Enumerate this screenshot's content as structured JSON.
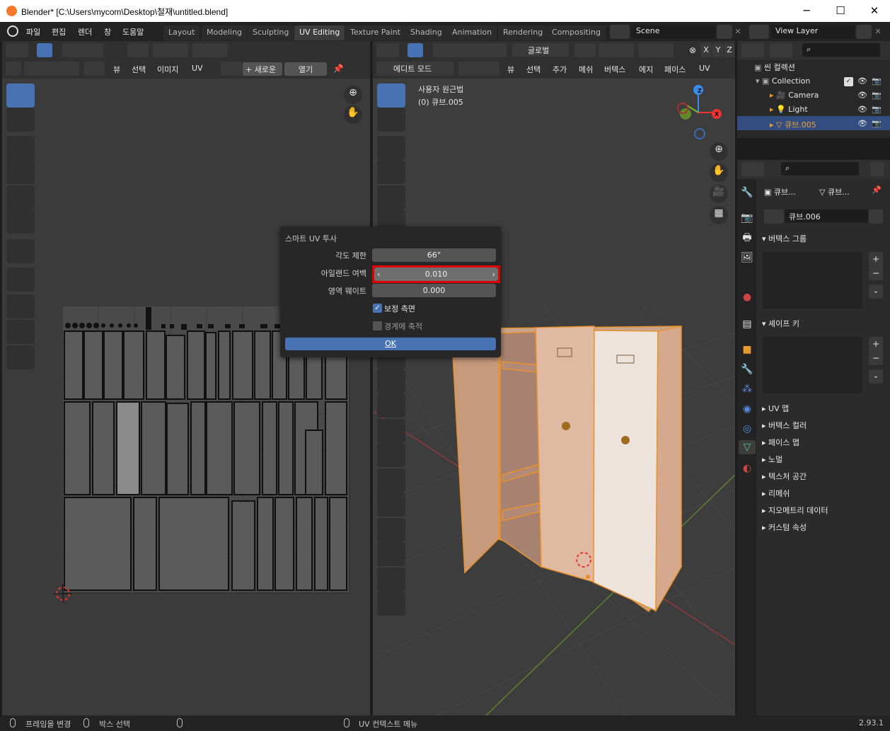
{
  "window": {
    "title": "Blender* [C:\\Users\\mycom\\Desktop\\철재\\untitled.blend]",
    "minimize": "─",
    "maximize": "☐",
    "close": "✕"
  },
  "menu": {
    "items": [
      "파일",
      "편집",
      "렌더",
      "창",
      "도움말"
    ]
  },
  "workspaces": [
    "Layout",
    "Modeling",
    "Sculpting",
    "UV Editing",
    "Texture Paint",
    "Shading",
    "Animation",
    "Rendering",
    "Compositing"
  ],
  "active_workspace": "UV Editing",
  "scene": {
    "name": "Scene",
    "view_layer": "View Layer"
  },
  "uv_editor": {
    "header_menus": [
      "뷰",
      "선택",
      "이미지",
      "UV"
    ],
    "new_btn": "+ 새로운",
    "open_btn": "열기"
  },
  "viewport": {
    "mode": "에디트 모드",
    "transform": "글로벌",
    "header_menus": [
      "뷰",
      "선택",
      "추가",
      "메쉬",
      "버텍스",
      "에지",
      "페이스",
      "UV"
    ],
    "view_title": "사용자 원근법",
    "object_name": "(0) 큐브.005",
    "axes": [
      "X",
      "Y",
      "Z"
    ]
  },
  "dialog": {
    "title": "스마트 UV 투사",
    "angle_label": "각도 제한",
    "angle_value": "66°",
    "margin_label": "아일랜드 여백",
    "margin_value": "0.010",
    "weight_label": "영역 웨이트",
    "weight_value": "0.000",
    "correct_aspect_label": "보정 측면",
    "correct_aspect_checked": true,
    "scale_bounds_label": "경계에 축적",
    "scale_bounds_checked": false,
    "ok_label": "OK",
    "highlight_color": "#e00000"
  },
  "outliner": {
    "scene_collection": "씬 컬렉션",
    "collection": "Collection",
    "items": [
      {
        "name": "Camera"
      },
      {
        "name": "Light"
      },
      {
        "name": "큐브.005",
        "selected": true
      }
    ]
  },
  "properties": {
    "obj_name": "큐브...",
    "data_name": "큐브...",
    "mesh_name": "큐브.006",
    "panels_open": [
      "버텍스 그룹",
      "셰이프 키"
    ],
    "panels_closed": [
      "UV 맵",
      "버텍스 컬러",
      "페이스 맵",
      "노멀",
      "텍스처 공간",
      "리메쉬",
      "지오메트리 데이터",
      "커스텀 속성"
    ]
  },
  "status": {
    "left1": "프레임을 변경",
    "left2": "박스 선택",
    "mid": "UV 컨텍스트 메뉴",
    "version": "2.93.1"
  },
  "colors": {
    "accent": "#4772b3",
    "active_obj": "#f0a030",
    "mesh_edge": "#e8922e"
  }
}
